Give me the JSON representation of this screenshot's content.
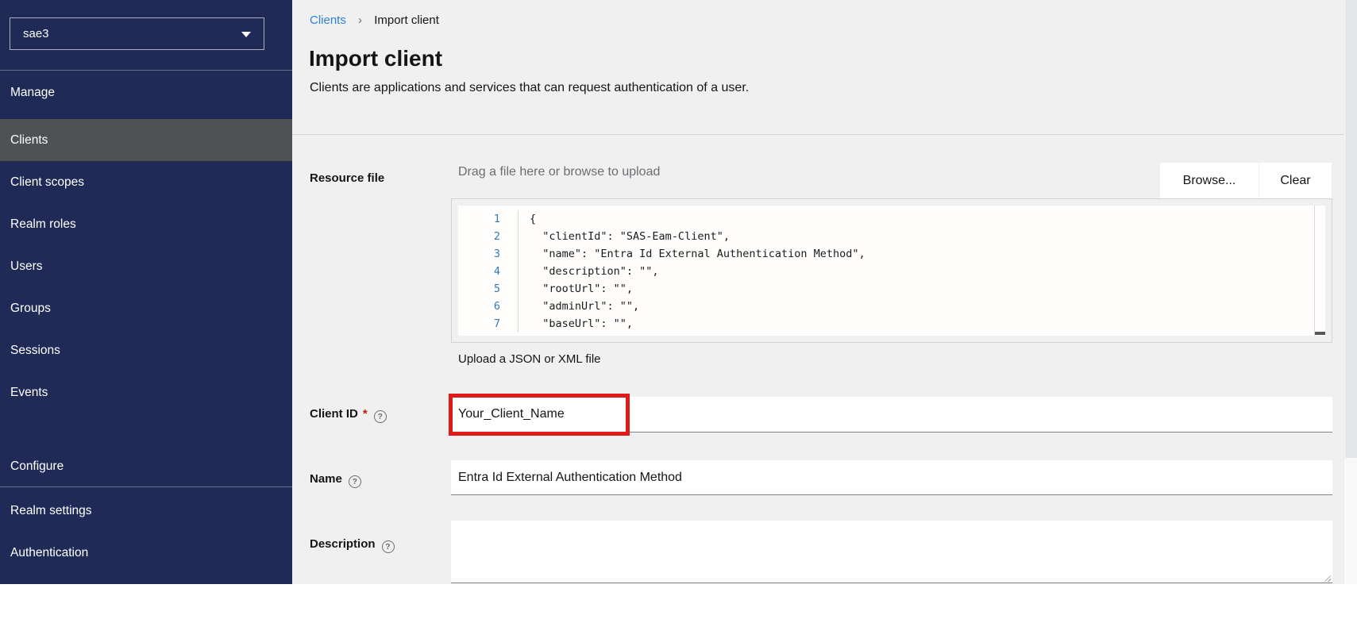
{
  "sidebar": {
    "realm": {
      "value": "sae3"
    },
    "groups": [
      {
        "label": "Manage",
        "items": [
          {
            "label": "Clients",
            "active": true
          },
          {
            "label": "Client scopes"
          },
          {
            "label": "Realm roles"
          },
          {
            "label": "Users"
          },
          {
            "label": "Groups"
          },
          {
            "label": "Sessions"
          },
          {
            "label": "Events"
          }
        ]
      },
      {
        "label": "Configure",
        "items": [
          {
            "label": "Realm settings"
          },
          {
            "label": "Authentication"
          }
        ]
      }
    ]
  },
  "breadcrumb": {
    "items": [
      {
        "label": "Clients"
      },
      {
        "label": "Import client"
      }
    ],
    "separator": "›"
  },
  "header": {
    "title": "Import client",
    "subtitle": "Clients are applications and services that can request authentication of a user."
  },
  "form": {
    "resource_file": {
      "label": "Resource file",
      "placeholder": "Drag a file here or browse to upload",
      "browse_label": "Browse...",
      "clear_label": "Clear",
      "helper_text": "Upload a JSON or XML file",
      "code_lines": [
        {
          "num": "1",
          "text": "{"
        },
        {
          "num": "2",
          "text": "  \"clientId\": \"SAS-Eam-Client\","
        },
        {
          "num": "3",
          "text": "  \"name\": \"Entra Id External Authentication Method\","
        },
        {
          "num": "4",
          "text": "  \"description\": \"\","
        },
        {
          "num": "5",
          "text": "  \"rootUrl\": \"\","
        },
        {
          "num": "6",
          "text": "  \"adminUrl\": \"\","
        },
        {
          "num": "7",
          "text": "  \"baseUrl\": \"\","
        }
      ]
    },
    "client_id": {
      "label": "Client ID",
      "required_marker": "*",
      "value": "Your_Client_Name"
    },
    "name": {
      "label": "Name",
      "value": "Entra Id External Authentication Method"
    },
    "description": {
      "label": "Description",
      "value": ""
    }
  },
  "icons": {
    "help_glyph": "?"
  },
  "colors": {
    "sidebar_bg": "#1f2b56",
    "active_item_bg": "#4f5255",
    "page_bg": "#f0f0f0",
    "link_blue": "#2f81d6",
    "highlight_red": "#e01a1a",
    "required_red": "#c9190b",
    "line_number_blue": "#2f7bb5"
  }
}
